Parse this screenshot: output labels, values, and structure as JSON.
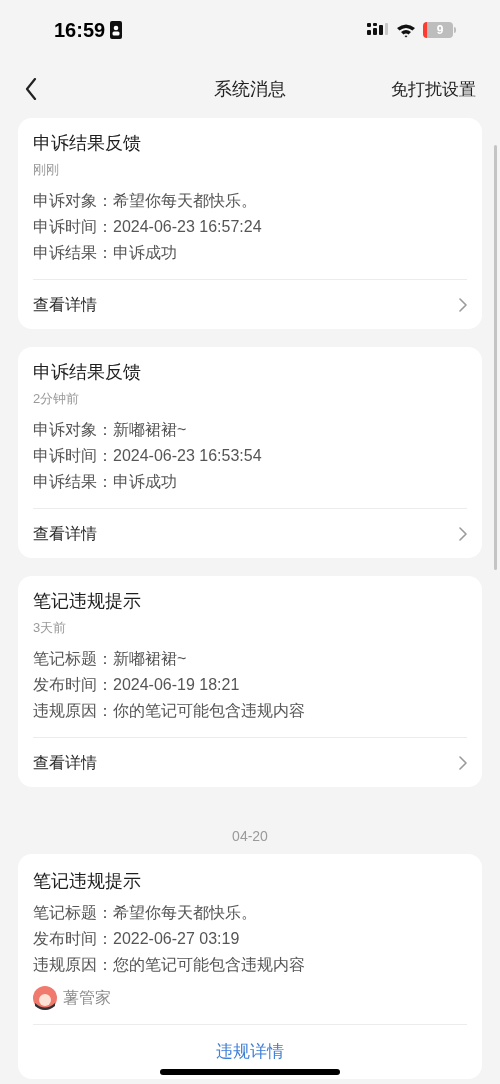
{
  "status_bar": {
    "time": "16:59",
    "battery": "9"
  },
  "nav": {
    "title": "系统消息",
    "action": "免打扰设置"
  },
  "messages": [
    {
      "title": "申诉结果反馈",
      "time": "刚刚",
      "lines": [
        "申诉对象：希望你每天都快乐。",
        "申诉时间：2024-06-23 16:57:24",
        "申诉结果：申诉成功"
      ],
      "footer": {
        "label": "查看详情",
        "kind": "row"
      }
    },
    {
      "title": "申诉结果反馈",
      "time": "2分钟前",
      "lines": [
        "申诉对象：新嘟裙裙~",
        "申诉时间：2024-06-23 16:53:54",
        "申诉结果：申诉成功"
      ],
      "footer": {
        "label": "查看详情",
        "kind": "row"
      }
    },
    {
      "title": "笔记违规提示",
      "time": "3天前",
      "lines": [
        "笔记标题：新嘟裙裙~",
        "发布时间：2024-06-19 18:21",
        "违规原因：你的笔记可能包含违规内容"
      ],
      "footer": {
        "label": "查看详情",
        "kind": "row"
      }
    },
    {
      "date_header": "04-20",
      "title": "笔记违规提示",
      "lines": [
        "笔记标题：希望你每天都快乐。",
        "发布时间：2022-06-27 03:19",
        "违规原因：您的笔记可能包含违规内容"
      ],
      "sender": {
        "name": "薯管家"
      },
      "footer": {
        "label": "违规详情",
        "kind": "center"
      }
    }
  ]
}
